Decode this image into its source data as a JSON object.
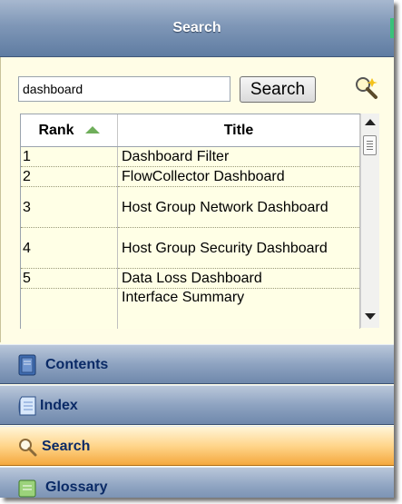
{
  "header": {
    "title": "Search"
  },
  "search": {
    "query": "dashboard",
    "button_label": "Search"
  },
  "results": {
    "columns": [
      "Rank",
      "Title"
    ],
    "sort_column": "Rank",
    "sort_direction": "ascending",
    "rows": [
      {
        "rank": "1",
        "title": "Dashboard Filter"
      },
      {
        "rank": "2",
        "title": "FlowCollector Dashboard"
      },
      {
        "rank": "3",
        "title": "Host Group Network Dashboard"
      },
      {
        "rank": "4",
        "title": "Host Group Security Dashboard"
      },
      {
        "rank": "5",
        "title": "Data Loss Dashboard"
      },
      {
        "rank": "",
        "title": "Interface Summary"
      }
    ]
  },
  "nav": {
    "items": [
      {
        "label": "Contents",
        "icon": "book-icon",
        "active": false
      },
      {
        "label": "Index",
        "icon": "index-page-icon",
        "active": false
      },
      {
        "label": "Search",
        "icon": "magnifier-icon",
        "active": true
      },
      {
        "label": "Glossary",
        "icon": "glossary-icon",
        "active": false
      }
    ]
  },
  "colors": {
    "title_bar": "#7f97b7",
    "pane_background": "#fffde6",
    "active_nav": "#ffd58b",
    "nav_text": "#0a2a66"
  }
}
